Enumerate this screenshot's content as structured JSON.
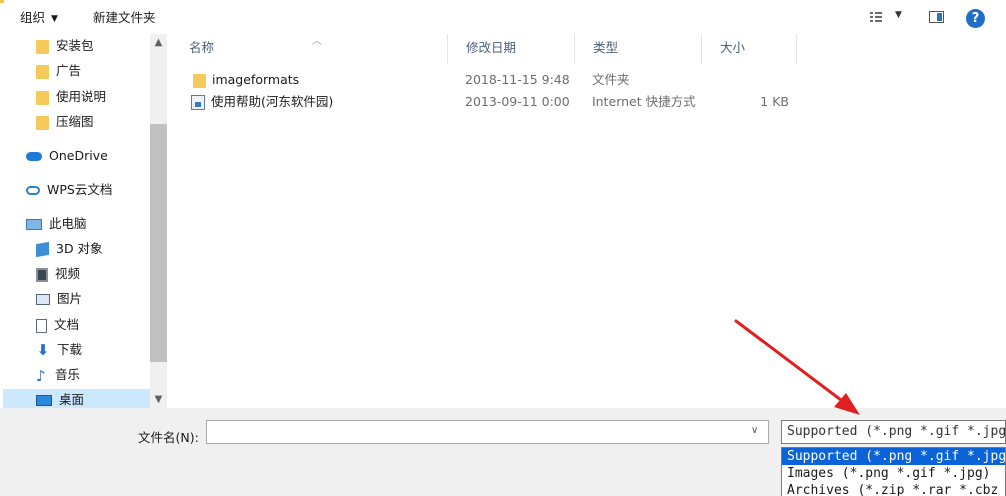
{
  "toolbar": {
    "organize_label": "组织",
    "new_folder_label": "新建文件夹",
    "help_label": "?"
  },
  "nav": {
    "items": [
      {
        "label": "安装包",
        "icon": "folder-icon"
      },
      {
        "label": "广告",
        "icon": "folder-icon"
      },
      {
        "label": "使用说明",
        "icon": "folder-icon"
      },
      {
        "label": "压缩图",
        "icon": "folder-icon"
      },
      {
        "label": "OneDrive",
        "icon": "cloud-icon"
      },
      {
        "label": "WPS云文档",
        "icon": "cloud-outline-icon"
      },
      {
        "label": "此电脑",
        "icon": "computer-icon"
      },
      {
        "label": "3D 对象",
        "icon": "cube-icon"
      },
      {
        "label": "视频",
        "icon": "video-icon"
      },
      {
        "label": "图片",
        "icon": "picture-icon"
      },
      {
        "label": "文档",
        "icon": "document-icon"
      },
      {
        "label": "下载",
        "icon": "download-icon"
      },
      {
        "label": "音乐",
        "icon": "music-icon"
      },
      {
        "label": "桌面",
        "icon": "desktop-icon"
      }
    ]
  },
  "columns": {
    "name": "名称",
    "modified": "修改日期",
    "type": "类型",
    "size": "大小"
  },
  "files": [
    {
      "name": "imageformats",
      "modified": "2018-11-15 9:48",
      "type": "文件夹",
      "size": "",
      "icon": "folder-icon"
    },
    {
      "name": "使用帮助(河东软件园)",
      "modified": "2013-09-11 0:00",
      "type": "Internet 快捷方式",
      "size": "1 KB",
      "icon": "internet-shortcut-icon"
    }
  ],
  "file_name": {
    "label": "文件名(N):",
    "value": ""
  },
  "filter": {
    "selected": "Supported (*.png *.gif *.jpg *.zip *.r",
    "options": [
      "Supported (*.png *.gif *.jpg *.zip *.r",
      "Images (*.png *.gif *.jpg)",
      "Archives (*.zip *.rar *.cbz *.cbr)"
    ]
  },
  "colors": {
    "accent": "#0a64d8",
    "selection_bg": "#cce8ff",
    "annotation_arrow": "#e02020"
  }
}
